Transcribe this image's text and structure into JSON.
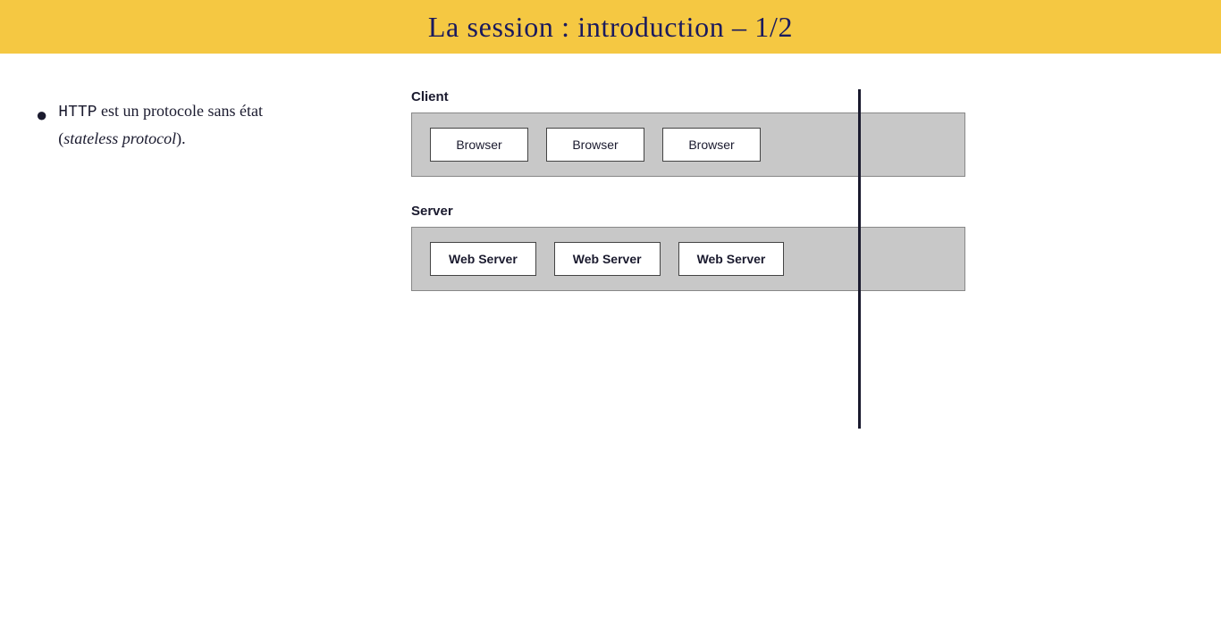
{
  "header": {
    "title": "La session : introduction – 1/2"
  },
  "left": {
    "bullet": {
      "dot": "●",
      "text_mono": "HTTP",
      "text_normal": " est un protocole sans état",
      "text_italic": "(stateless protocol)",
      "text_end": "."
    }
  },
  "right": {
    "client": {
      "label": "Client",
      "boxes": [
        "Browser",
        "Browser",
        "Browser"
      ]
    },
    "server": {
      "label": "Server",
      "boxes": [
        "Web Server",
        "Web Server",
        "Web Server"
      ]
    }
  }
}
